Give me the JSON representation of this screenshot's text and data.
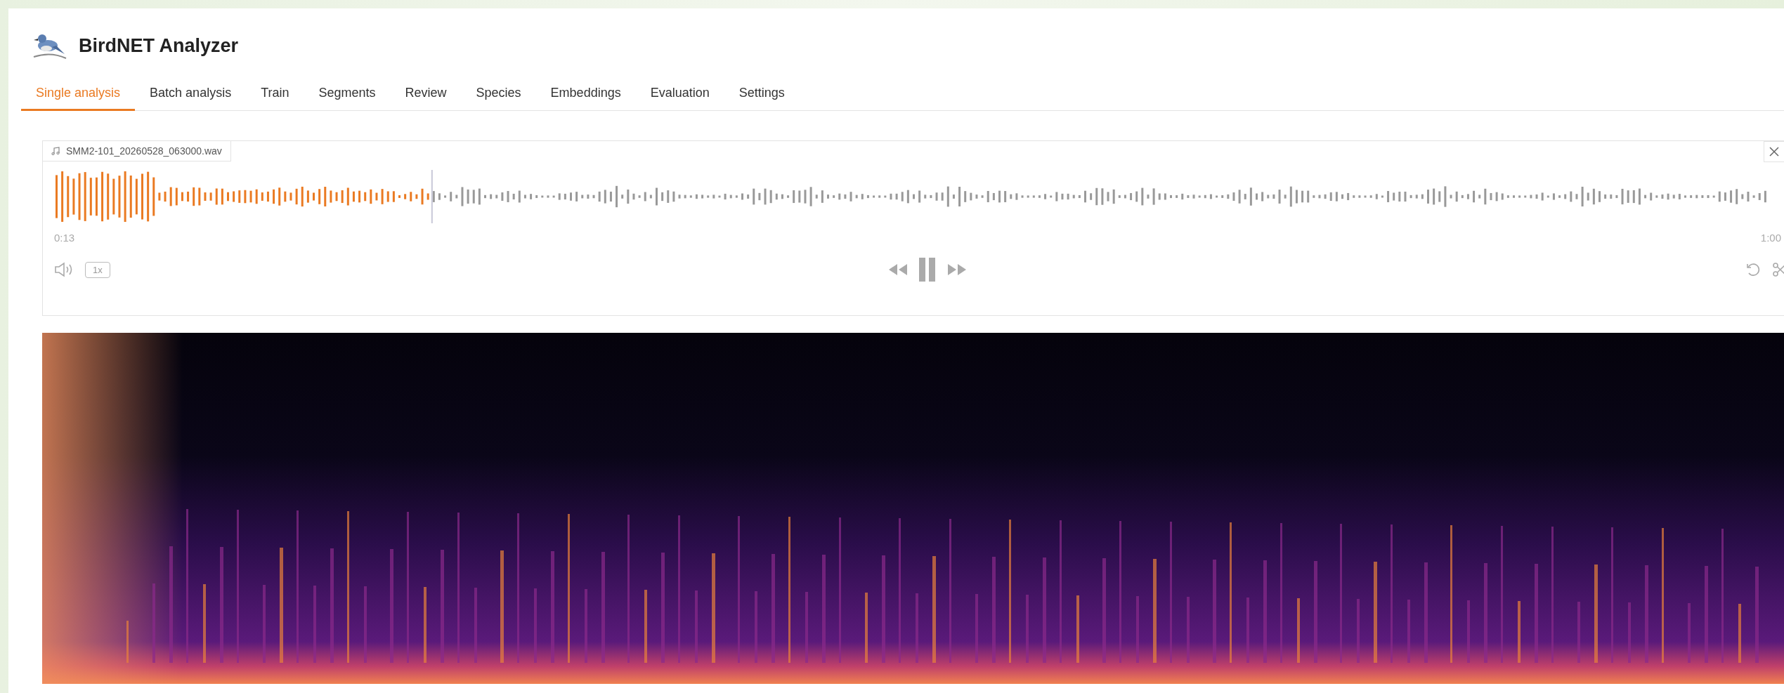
{
  "app": {
    "title": "BirdNET Analyzer"
  },
  "tabs": [
    {
      "label": "Single analysis",
      "selected": true
    },
    {
      "label": "Batch analysis",
      "selected": false
    },
    {
      "label": "Train",
      "selected": false
    },
    {
      "label": "Segments",
      "selected": false
    },
    {
      "label": "Review",
      "selected": false
    },
    {
      "label": "Species",
      "selected": false
    },
    {
      "label": "Embeddings",
      "selected": false
    },
    {
      "label": "Evaluation",
      "selected": false
    },
    {
      "label": "Settings",
      "selected": false
    }
  ],
  "player": {
    "file_name": "SMM2-101_20260528_063000.wav",
    "progress": {
      "level": 0.22
    },
    "current_time": "0:13",
    "duration": "1:00",
    "speed": "1x"
  }
}
